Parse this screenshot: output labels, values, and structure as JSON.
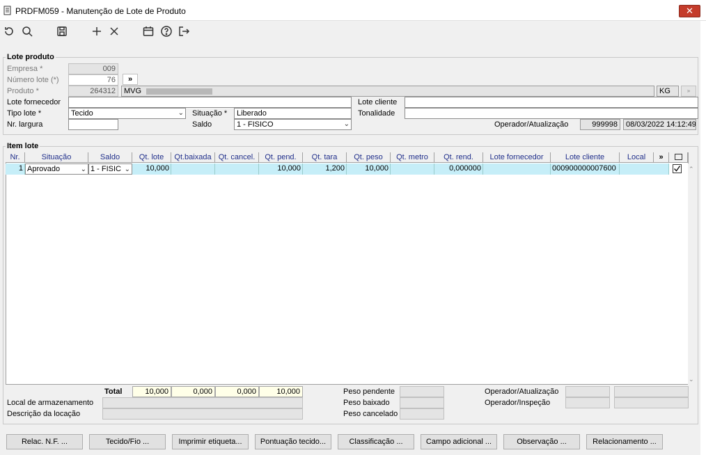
{
  "window": {
    "title": "PRDFM059 - Manutenção de Lote de Produto",
    "close_glyph": "✕"
  },
  "toolbar": {
    "icons": [
      "refresh-icon",
      "search-icon",
      "save-icon",
      "add-icon",
      "delete-icon",
      "calendar-icon",
      "help-icon",
      "exit-icon"
    ]
  },
  "lote_produto": {
    "title": "Lote produto",
    "empresa_label": "Empresa *",
    "empresa_value": "009",
    "numero_lote_label": "Número lote (*)",
    "numero_lote_value": "76",
    "produto_label": "Produto *",
    "produto_value": "264312",
    "produto_desc": "MVG",
    "produto_nav": "»",
    "unidade": "KG",
    "lote_fornecedor_label": "Lote fornecedor",
    "lote_fornecedor_value": "",
    "lote_cliente_label": "Lote cliente",
    "lote_cliente_value": "",
    "tipo_lote_label": "Tipo lote *",
    "tipo_lote_value": "Tecido",
    "situacao_label": "Situação *",
    "situacao_value": "Liberado",
    "tonalidade_label": "Tonalidade",
    "tonalidade_value": "",
    "nr_largura_label": "Nr. largura",
    "nr_largura_value": "",
    "saldo_label": "Saldo",
    "saldo_value": "1 - FISICO",
    "operador_label": "Operador/Atualização",
    "operador_value": "999998",
    "data_atualizacao": "08/03/2022 14:12:49"
  },
  "item_lote": {
    "title": "Item lote",
    "columns": [
      "Nr.",
      "Situação",
      "Saldo",
      "Qt. lote",
      "Qt.baixada",
      "Qt. cancel.",
      "Qt. pend.",
      "Qt. tara",
      "Qt. peso",
      "Qt. metro",
      "Qt. rend.",
      "Lote fornecedor",
      "Lote cliente",
      "Local",
      "»",
      ""
    ],
    "rows": [
      {
        "nr": "1",
        "situacao": "Aprovado",
        "saldo": "1 - FISIC",
        "qt_lote": "10,000",
        "qt_baixada": "",
        "qt_cancel": "",
        "qt_pend": "10,000",
        "qt_tara": "1,200",
        "qt_peso": "10,000",
        "qt_metro": "",
        "qt_rend": "0,000000",
        "lote_fornecedor": "",
        "lote_cliente": "000900000007600",
        "local": "",
        "checked": true
      }
    ]
  },
  "totals": {
    "label": "Total",
    "qt_lote": "10,000",
    "qt_baixada": "0,000",
    "qt_cancel": "0,000",
    "qt_pend": "10,000"
  },
  "footer": {
    "local_armazenamento_label": "Local de armazenamento",
    "descricao_locacao_label": "Descrição da locação",
    "peso_pendente_label": "Peso pendente",
    "peso_baixado_label": "Peso baixado",
    "peso_cancelado_label": "Peso cancelado",
    "operador_atualizacao_label": "Operador/Atualização",
    "operador_inspecao_label": "Operador/Inspeção"
  },
  "buttons": {
    "relac_nf": "Relac. N.F. ...",
    "tecido_fio": "Tecido/Fio ...",
    "imprimir_etiqueta": "Imprimir etiqueta...",
    "pontuacao_tecido": "Pontuação tecido...",
    "classificacao": "Classificação ...",
    "campo_adicional": "Campo adicional ...",
    "observacao": "Observação ...",
    "relacionamento": "Relacionamento ..."
  }
}
